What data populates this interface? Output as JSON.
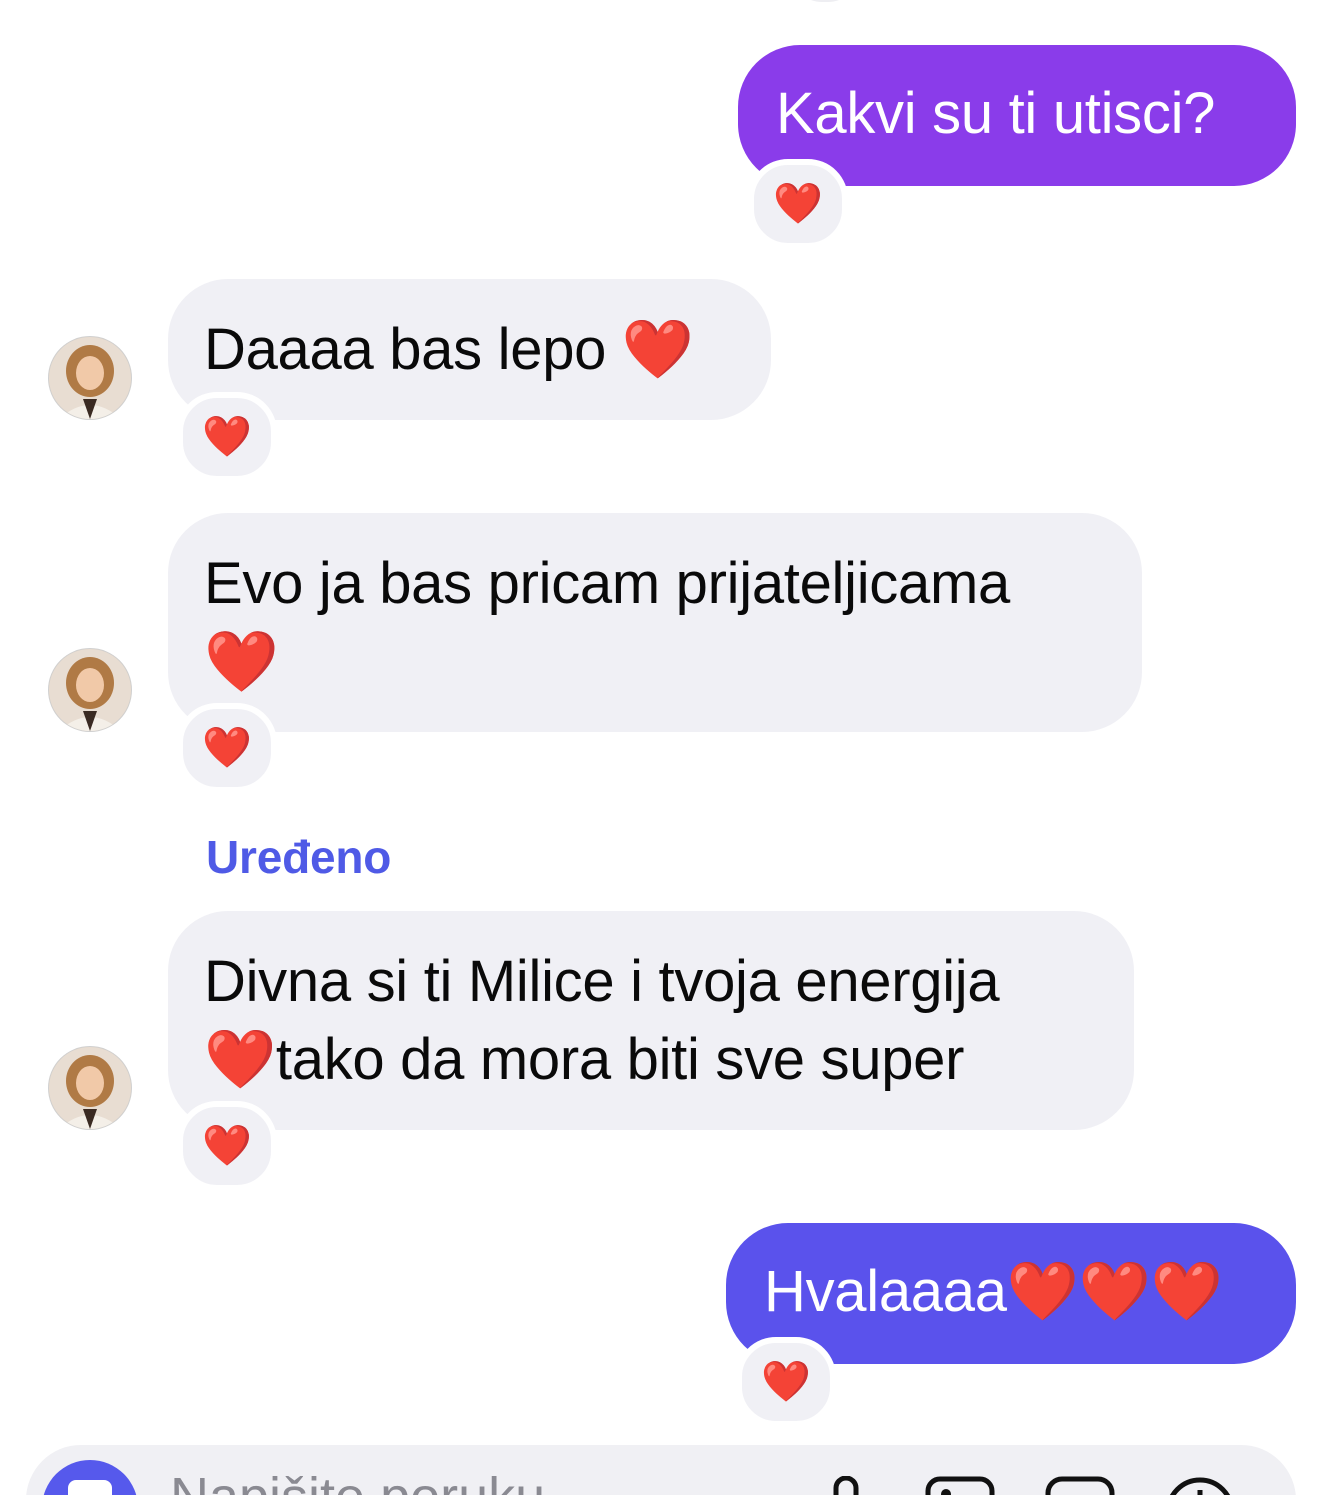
{
  "colors": {
    "outgoing_bubble_top": "#8a3cea",
    "outgoing_bubble_bottom": "#5a52ec",
    "incoming_bubble": "#f0f0f5",
    "edited_label": "#4f5ae6",
    "heart": "#e4172b",
    "camera_button": "#5659ec"
  },
  "messages": [
    {
      "direction": "outgoing",
      "lines": [
        "Kakvi su ti utisci?"
      ],
      "reaction": "❤️"
    },
    {
      "direction": "incoming",
      "lines": [
        "Daaaa bas lepo ❤️"
      ],
      "reaction": "❤️"
    },
    {
      "direction": "incoming",
      "lines": [
        "Evo ja bas pricam prijateljicama",
        "❤️"
      ],
      "reaction": "❤️"
    },
    {
      "direction": "incoming",
      "edited_label": "Uređeno",
      "lines": [
        "Divna si ti Milice i tvoja energija",
        "❤️tako da mora biti sve super"
      ],
      "reaction": "❤️"
    },
    {
      "direction": "outgoing",
      "lines": [
        "Hvalaaaa❤️❤️❤️"
      ],
      "reaction": "❤️"
    }
  ],
  "composer": {
    "placeholder": "Napišite poruku...",
    "icons": [
      "camera-icon",
      "microphone-icon",
      "image-icon",
      "sticker-icon",
      "add-icon"
    ]
  }
}
